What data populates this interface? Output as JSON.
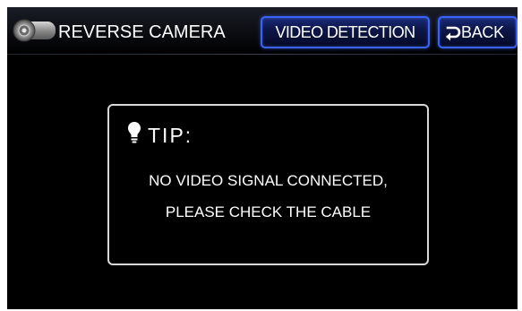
{
  "header": {
    "title": "REVERSE CAMERA",
    "title_icon": "camera-icon",
    "buttons": {
      "video_detection": "VIDEO DETECTION",
      "back": "BACK",
      "back_icon": "return-arrow-icon"
    }
  },
  "tip": {
    "icon": "lightbulb-icon",
    "title": "TIP:",
    "lines": [
      "NO VIDEO SIGNAL CONNECTED,",
      "PLEASE CHECK THE CABLE"
    ]
  },
  "colors": {
    "screen_background": "#000000",
    "button_border": "#3a62ff",
    "button_fill": "#0d1648",
    "text": "#ffffff",
    "tip_border": "#d8d8d8"
  }
}
